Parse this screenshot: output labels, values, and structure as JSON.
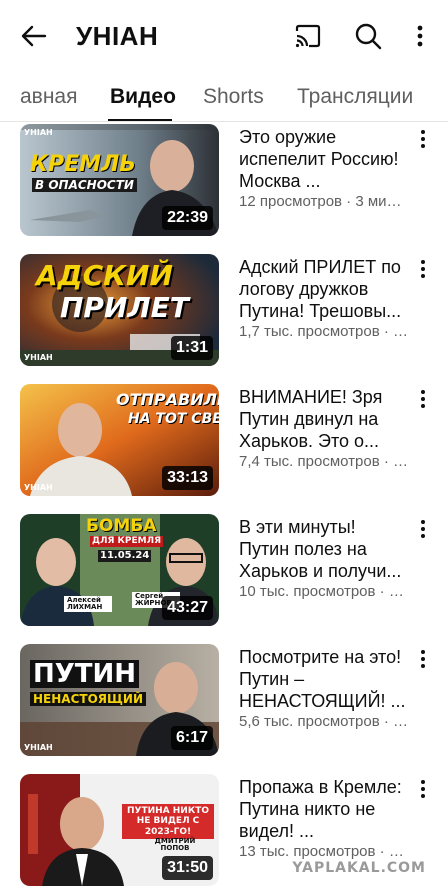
{
  "header": {
    "title": "УНІАН",
    "icons": [
      "back-arrow-icon",
      "cast-icon",
      "search-icon",
      "more-vert-icon"
    ]
  },
  "tabs": [
    {
      "label": "авная",
      "active": false
    },
    {
      "label": "Видео",
      "active": true
    },
    {
      "label": "Shorts",
      "active": false
    },
    {
      "label": "Трансляции",
      "active": false
    }
  ],
  "videos": [
    {
      "title": "Это оружие испепелит Россию! Москва ...",
      "stats": "12 просмотров · 3 мину...",
      "duration": "22:39",
      "thumb_text": [
        "КРЕМЛЬ",
        "В ОПАСНОСТИ"
      ]
    },
    {
      "title": "Адский ПРИЛЕТ по логову дружков Путина! Трешовы...",
      "stats": "1,7 тыс. просмотров · 1...",
      "duration": "1:31",
      "thumb_text": [
        "АДСКИЙ",
        "ПРИЛЕТ"
      ]
    },
    {
      "title": "ВНИМАНИЕ! Зря Путин двинул на Харьков. Это о...",
      "stats": "7,4 тыс. просмотров · 3...",
      "duration": "33:13",
      "thumb_text": [
        "ОТПРАВИЛИ",
        "НА ТОТ СВЕТ"
      ]
    },
    {
      "title": "В эти минуты! Путин полез на Харьков и получи...",
      "stats": "10 тыс. просмотров · 3...",
      "duration": "43:27",
      "thumb_text": [
        "БОМБА",
        "ДЛЯ КРЕМЛЯ",
        "11.05.24",
        "Алексей ЛИХМАН",
        "Сергей ЖИРНОВ"
      ]
    },
    {
      "title": "Посмотрите на это! Путин – НЕНАСТОЯЩИЙ! ...",
      "stats": "5,6 тыс. просмотров · 3...",
      "duration": "6:17",
      "thumb_text": [
        "ПУТИН",
        "НЕНАСТОЯЩИЙ"
      ]
    },
    {
      "title": "Пропажа в Кремле: Путина никто не видел! ...",
      "stats": "13 тыс. просмотров · 3...",
      "duration": "31:50",
      "thumb_text": [
        "ПУТИНА НИКТО НЕ ВИДЕЛ С 2023-ГО!",
        "ДМИТРИЙ ПОПОВ"
      ]
    }
  ],
  "channel_logo": "УНІАН",
  "watermark": "YAPLAKAL.COM",
  "colors": {
    "text_primary": "#0f0f0f",
    "text_secondary": "#606060",
    "thumb_yellow": "#f5d20a",
    "thumb_red": "#e0261b",
    "duration_bg": "#000000"
  }
}
